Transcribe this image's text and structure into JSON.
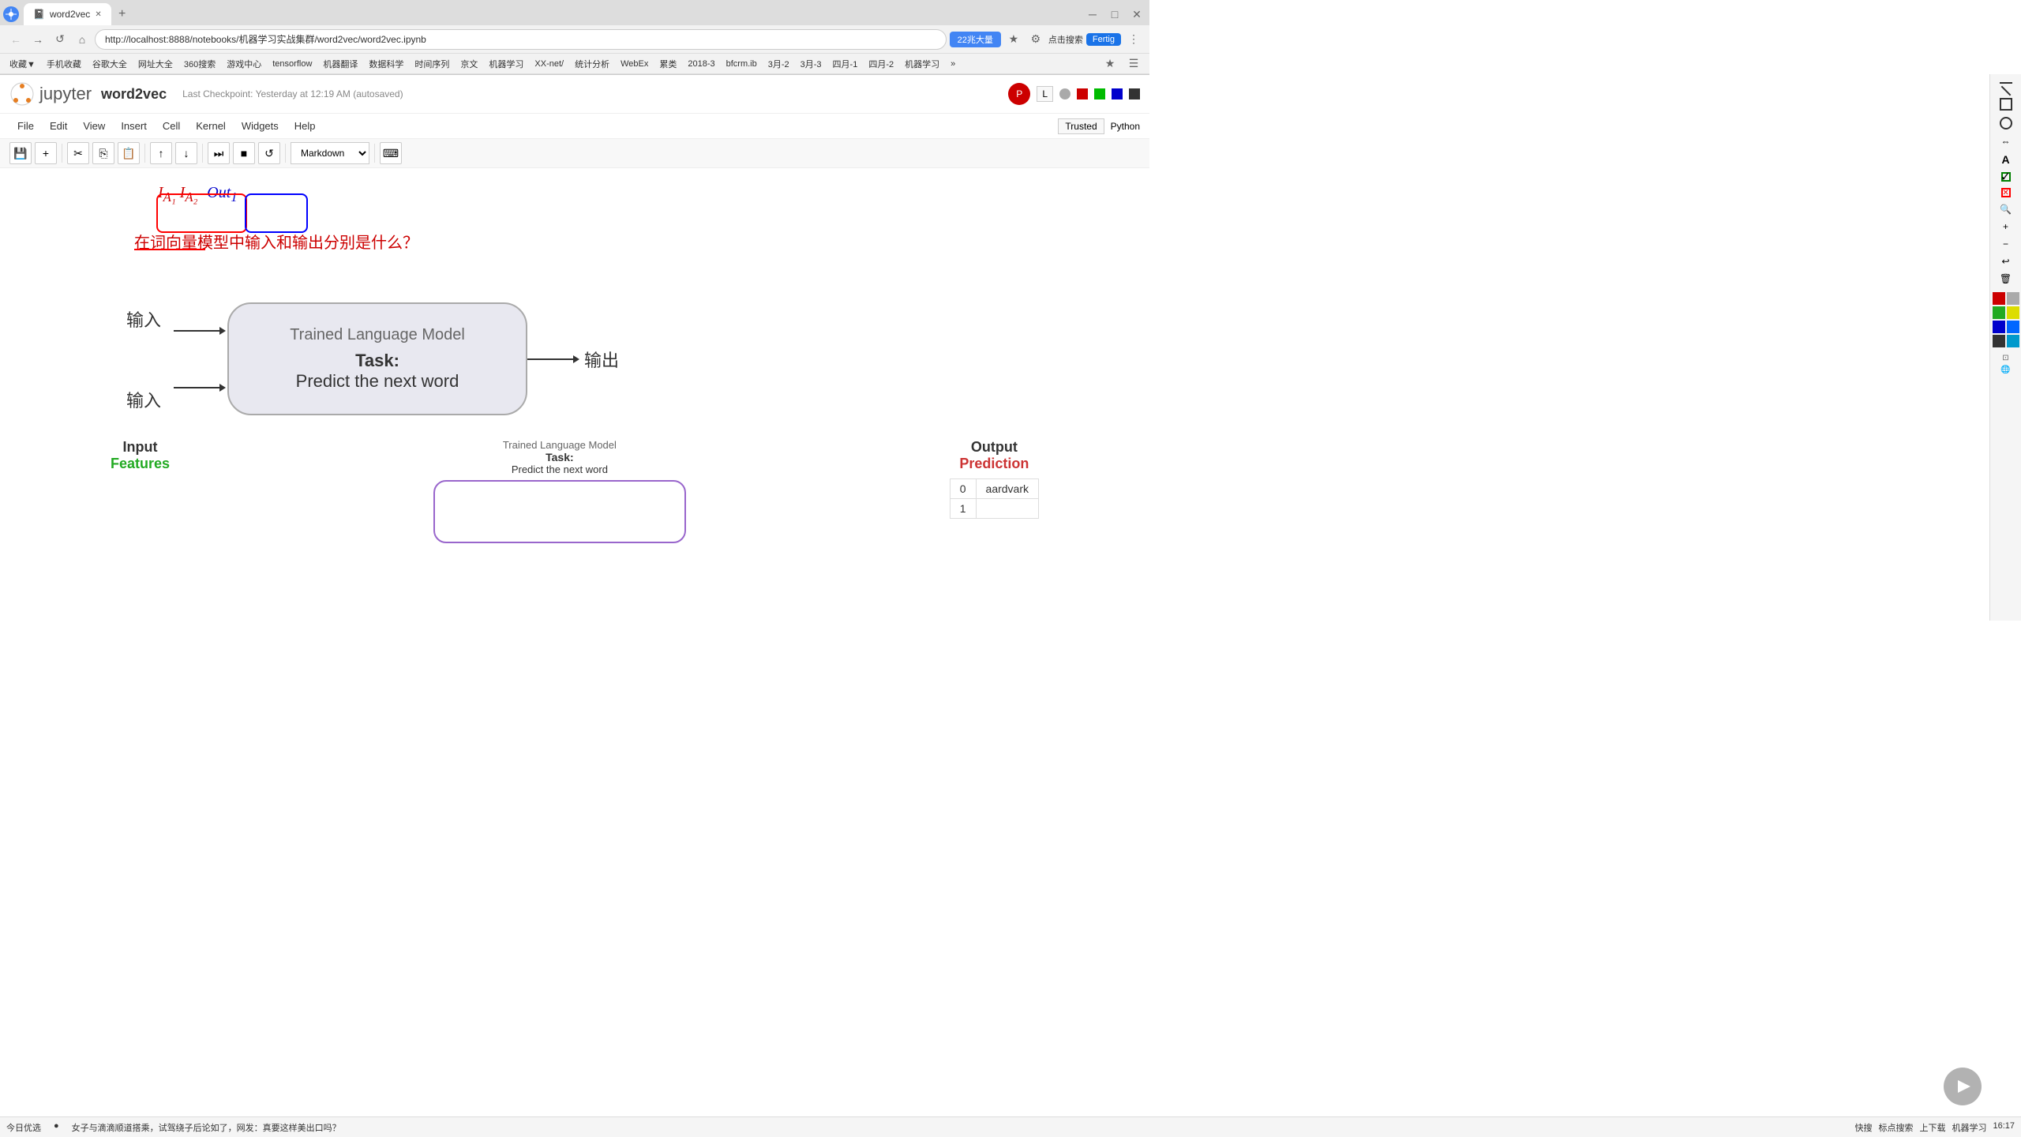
{
  "browser": {
    "tab_title": "word2vec",
    "url": "http://localhost:8888/notebooks/机器学习实战集群/word2vec/word2vec.ipynb",
    "search_btn": "22兆大量",
    "search_placeholder": "点击搜索",
    "fertig_btn": "Fertig"
  },
  "bookmarks": [
    "收藏▼",
    "手机收藏",
    "谷歌大全",
    "网址大全",
    "360搜索",
    "游戏中心",
    "tensorflow",
    "机器翻译",
    "数据科学",
    "时间序列",
    "京文",
    "机器学习",
    "XX-net/",
    "统计分析",
    "WebEx",
    "累类",
    "2018-3",
    "bfcrm.ib",
    "3月-2",
    "3月-3",
    "四月-1",
    "四月-2",
    "机器学习",
    "»"
  ],
  "jupyter": {
    "logo_text": "jupyter",
    "notebook_name": "word2vec",
    "checkpoint": "Last Checkpoint: Yesterday at 12:19 AM (autosaved)"
  },
  "menu": {
    "items": [
      "File",
      "Edit",
      "View",
      "Insert",
      "Cell",
      "Kernel",
      "Widgets",
      "Help"
    ],
    "trusted_btn": "Trusted",
    "python_indicator": "Python"
  },
  "toolbar": {
    "cell_type": "Markdown",
    "keyboard_shortcut": "⌨"
  },
  "annotation": {
    "math_text": "I_{A₁} I_{A₂}",
    "math_blue": "Out₁",
    "question": "在词向量模型中输入和输出分别是什么？"
  },
  "main_diagram": {
    "input_labels": [
      "输入",
      "输入"
    ],
    "model_title": "Trained Language Model",
    "task_label": "Task:",
    "task_desc": "Predict the next word",
    "output_label": "输出"
  },
  "second_diagram": {
    "input_title": "Input",
    "input_subtitle": "Features",
    "model_title": "Trained Language Model",
    "task_label": "Task:",
    "task_desc": "Predict the next word",
    "output_title": "Output",
    "output_subtitle": "Prediction"
  },
  "table": {
    "rows": [
      {
        "index": "0",
        "value": "aardvark"
      },
      {
        "index": "1",
        "value": "..."
      }
    ]
  },
  "status_bar": {
    "daily_message": "今日优选",
    "news_text": "女子与滴滴顺道搭乘，试驾绕子后论如了，网发：真要这样美出口吗？",
    "tools": [
      "快搜",
      "标点搜索",
      "上下载",
      "机器学习"
    ],
    "time": "16:17"
  },
  "right_sidebar": {
    "colors": [
      "#cc0000",
      "#ff0000",
      "#00aa00",
      "#00cc00",
      "#0000cc",
      "#0000ff",
      "#333333",
      "#000000",
      "#aaaaaa",
      "#ffffff"
    ]
  }
}
